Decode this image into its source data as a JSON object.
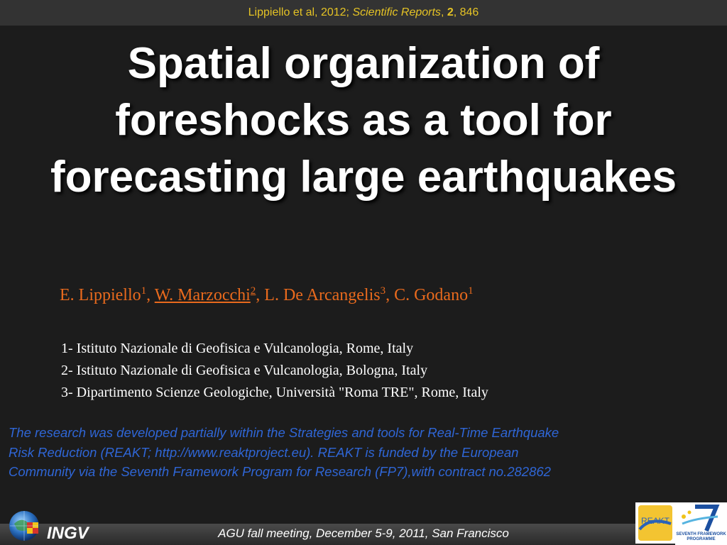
{
  "header": {
    "citation_authors": "Lippiello et al, 2012; ",
    "journal": "Scientific Reports",
    "sep1": ", ",
    "volume": "2",
    "sep2": ", ",
    "page": "846"
  },
  "title": {
    "lines": [
      "Spatial organization of",
      "foreshocks as a tool for",
      "forecasting large earthquakes"
    ]
  },
  "authors": [
    {
      "name": "E. Lippiello",
      "sup": "1",
      "underline": false,
      "sep": ", "
    },
    {
      "name": "W. Marzocchi",
      "sup": "2",
      "underline": true,
      "sep": ", "
    },
    {
      "name": "L. De Arcangelis",
      "sup": "3",
      "underline": false,
      "sep": ", "
    },
    {
      "name": "C. Godano",
      "sup": "1",
      "underline": false,
      "sep": ""
    }
  ],
  "affiliations": [
    "1- Istituto Nazionale di Geofisica e Vulcanologia, Rome, Italy",
    "2- Istituto Nazionale di Geofisica e Vulcanologia, Bologna, Italy",
    "3- Dipartimento Scienze Geologiche, Università \"Roma TRE\", Rome, Italy"
  ],
  "funding_note": {
    "lines": [
      "The research was developed partially within the Strategies and tools for Real-Time Earthquake",
      "Risk Reduction (REAKT; http://www.reaktproject.eu). REAKT is funded by the European",
      "Community via the Seventh Framework Program for Research (FP7),with contract no.282862"
    ]
  },
  "footer": {
    "meeting": "AGU fall meeting, December 5-9, 2011, San Francisco",
    "ingv_label": "INGV",
    "reakt_logo_text": "REAKT",
    "fp7_logo_text": "SEVENTH FRAMEWORK PROGRAMME"
  },
  "colors": {
    "background": "#1c1c1c",
    "header_text": "#e5c325",
    "authors": "#e96a1d",
    "note": "#2f66d6"
  }
}
